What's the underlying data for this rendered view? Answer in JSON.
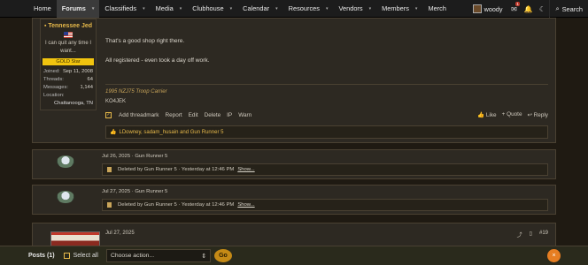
{
  "nav": {
    "items": [
      {
        "label": "Home",
        "chevron": false,
        "active": false
      },
      {
        "label": "Forums",
        "chevron": true,
        "active": true
      },
      {
        "label": "Classifieds",
        "chevron": true,
        "active": false
      },
      {
        "label": "Media",
        "chevron": true,
        "active": false
      },
      {
        "label": "Clubhouse",
        "chevron": true,
        "active": false
      },
      {
        "label": "Calendar",
        "chevron": true,
        "active": false
      },
      {
        "label": "Resources",
        "chevron": true,
        "active": false
      },
      {
        "label": "Vendors",
        "chevron": true,
        "active": false
      },
      {
        "label": "Members",
        "chevron": true,
        "active": false
      },
      {
        "label": "Merch",
        "chevron": false,
        "active": false
      }
    ],
    "username": "woody",
    "inbox_badge": "1",
    "search_label": "Search"
  },
  "post1": {
    "author": {
      "name": "Tennessee Jed",
      "title": "I can quit any time I want...",
      "badge": "GOLD Star",
      "joined_label": "Joined:",
      "joined": "Sep 11, 2008",
      "threads_label": "Threads:",
      "threads": "64",
      "messages_label": "Messages:",
      "messages": "1,144",
      "location_label": "Location:",
      "location": "Chattanooga, TN"
    },
    "line1": "That's a good shop right there.",
    "line2": "All registered - even took a day off work.",
    "sig1": "1995 NZJ75 Troop Carrier",
    "sig2": "KO4JEK",
    "actions_left": [
      "Add threadmark",
      "Report",
      "Edit",
      "Delete",
      "IP",
      "Warn"
    ],
    "actions_right": [
      "Like",
      "+ Quote",
      "Reply"
    ],
    "reactions": "LDowney, sadam_husain and Gun Runner 5"
  },
  "deleted_posts": [
    {
      "meta": "Jul 26, 2025 · Gun Runner 5",
      "text": "Deleted by Gun Runner 5 · Yesterday at 12:46 PM",
      "show": "Show..."
    },
    {
      "meta": "Jul 27, 2025 · Gun Runner 5",
      "text": "Deleted by Gun Runner 5 · Yesterday at 12:46 PM",
      "show": "Show..."
    }
  ],
  "post4": {
    "date": "Jul 27, 2025",
    "number": "#19"
  },
  "footer": {
    "posts_label": "Posts (1)",
    "select_all": "Select all",
    "dropdown": "Choose action...",
    "go": "Go",
    "close": "×"
  },
  "colors": {
    "accent": "#e7b94a",
    "bg": "#1f1a12",
    "panel": "#2d2922",
    "nav": "#1c1c1c"
  }
}
